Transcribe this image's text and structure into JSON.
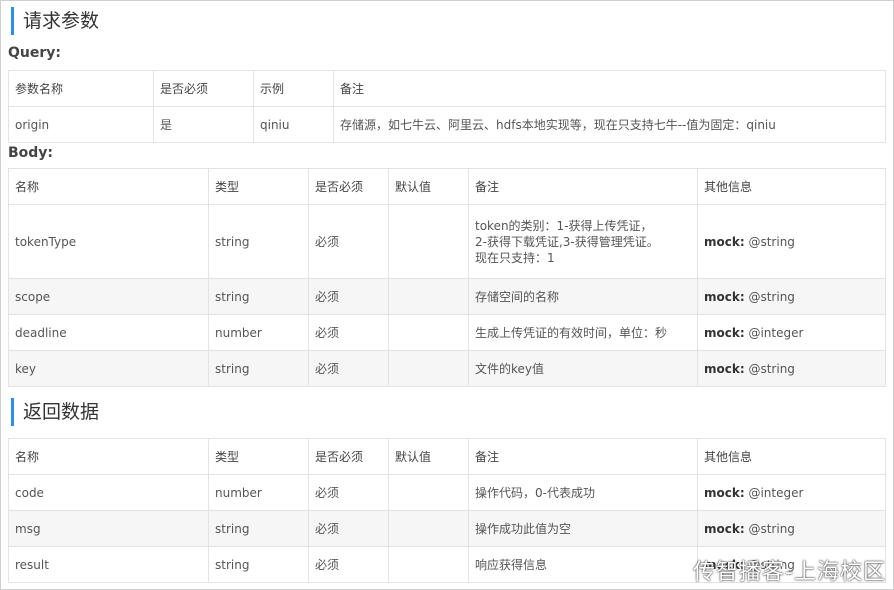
{
  "request": {
    "title": "请求参数",
    "query_label": "Query:",
    "query_headers": [
      "参数名称",
      "是否必须",
      "示例",
      "备注"
    ],
    "query_rows": [
      [
        "origin",
        "是",
        "qiniu",
        "存储源，如七牛云、阿里云、hdfs本地实现等，现在只支持七牛--值为固定：qiniu"
      ]
    ],
    "body_label": "Body:",
    "body_headers": [
      "名称",
      "类型",
      "是否必须",
      "默认值",
      "备注",
      "其他信息"
    ],
    "body_rows": [
      {
        "name": "tokenType",
        "type": "string",
        "required": "必须",
        "default": "",
        "note_lines": [
          "token的类别：1-获得上传凭证，",
          "2-获得下载凭证,3-获得管理凭证。",
          "现在只支持：1"
        ],
        "mock_label": "mock:",
        "mock_value": "@string"
      },
      {
        "name": "scope",
        "type": "string",
        "required": "必须",
        "default": "",
        "note_lines": [
          "存储空间的名称"
        ],
        "mock_label": "mock:",
        "mock_value": "@string"
      },
      {
        "name": "deadline",
        "type": "number",
        "required": "必须",
        "default": "",
        "note_lines": [
          "生成上传凭证的有效时间，单位：秒"
        ],
        "mock_label": "mock:",
        "mock_value": "@integer"
      },
      {
        "name": "key",
        "type": "string",
        "required": "必须",
        "default": "",
        "note_lines": [
          "文件的key值"
        ],
        "mock_label": "mock:",
        "mock_value": "@string"
      }
    ]
  },
  "response": {
    "title": "返回数据",
    "headers": [
      "名称",
      "类型",
      "是否必须",
      "默认值",
      "备注",
      "其他信息"
    ],
    "rows": [
      {
        "name": "code",
        "type": "number",
        "required": "必须",
        "default": "",
        "note": "操作代码，0-代表成功",
        "mock_label": "mock:",
        "mock_value": "@integer"
      },
      {
        "name": "msg",
        "type": "string",
        "required": "必须",
        "default": "",
        "note": "操作成功此值为空",
        "mock_label": "mock:",
        "mock_value": "@string"
      },
      {
        "name": "result",
        "type": "string",
        "required": "必须",
        "default": "",
        "note": "响应获得信息",
        "mock_label": "mock:",
        "mock_value": "@string"
      }
    ]
  },
  "watermark": "传智播客-上海校区"
}
